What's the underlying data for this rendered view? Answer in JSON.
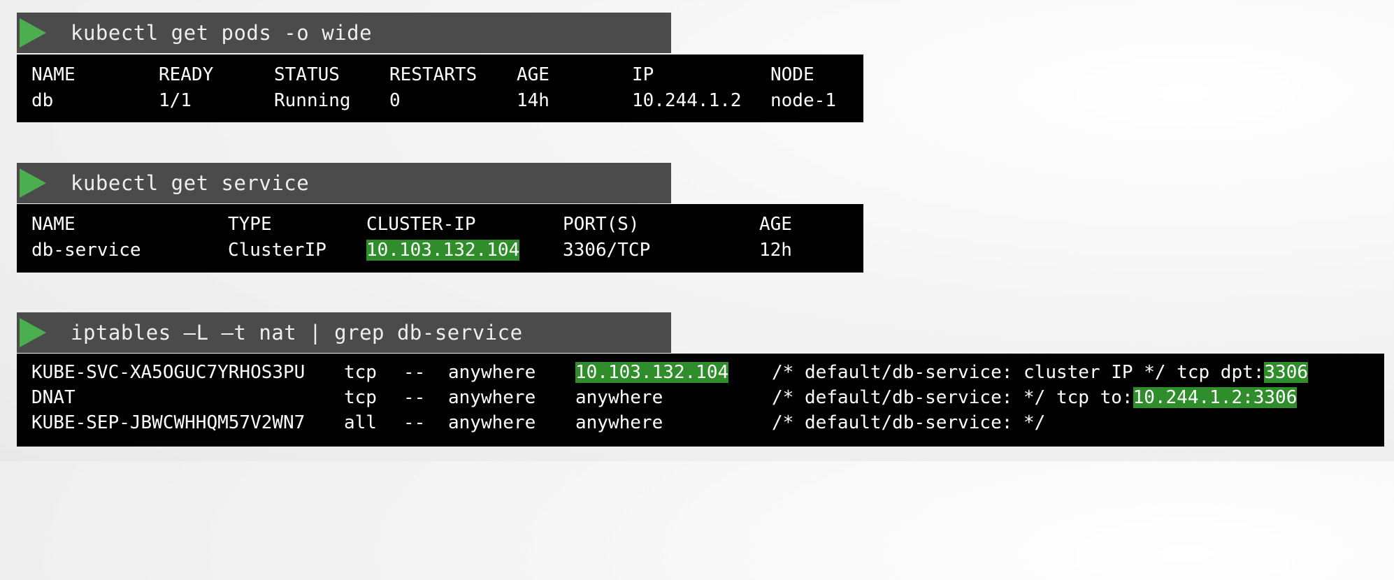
{
  "commands": {
    "pods": "kubectl get pods -o wide",
    "service": "kubectl get service",
    "iptables": "iptables –L –t nat | grep db-service"
  },
  "pods": {
    "headers": [
      "NAME",
      "READY",
      "STATUS",
      "RESTARTS",
      "AGE",
      "IP",
      "NODE"
    ],
    "row": [
      "db",
      "1/1",
      "Running",
      "0",
      "14h",
      "10.244.1.2",
      "node-1"
    ]
  },
  "service": {
    "headers": [
      "NAME",
      "TYPE",
      "CLUSTER-IP",
      "PORT(S)",
      "AGE"
    ],
    "row": [
      "db-service",
      "ClusterIP",
      "10.103.132.104",
      "3306/TCP",
      "12h"
    ]
  },
  "iptables": {
    "rows": [
      {
        "target": "KUBE-SVC-XA5OGUC7YRHOS3PU",
        "prot": "tcp",
        "opt": "--",
        "source": "anywhere",
        "destination": "10.103.132.104",
        "comment": "/* default/db-service: cluster IP */ tcp dpt:",
        "highlight": "3306"
      },
      {
        "target": "DNAT",
        "prot": "tcp",
        "opt": "--",
        "source": "anywhere",
        "destination": "anywhere",
        "comment": "/* default/db-service: */ tcp to:",
        "highlight": "10.244.1.2:3306"
      },
      {
        "target": "KUBE-SEP-JBWCWHHQM57V2WN7",
        "prot": "all",
        "opt": "--",
        "source": "anywhere",
        "destination": "anywhere",
        "comment": "/* default/db-service: */",
        "highlight": ""
      }
    ]
  },
  "colors": {
    "command_bar": "#4b4b4b",
    "play_icon": "#4bae4f",
    "terminal_bg": "#000000",
    "highlight": "#2f8e2b"
  }
}
